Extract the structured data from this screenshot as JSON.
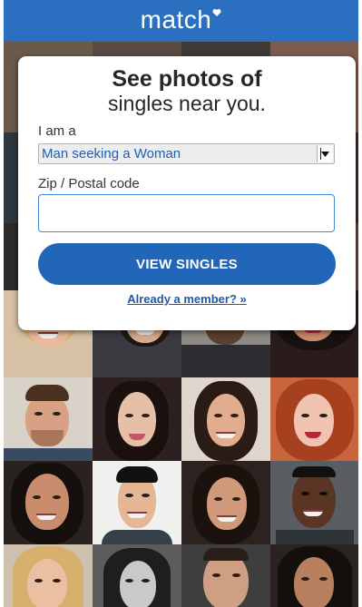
{
  "brand": {
    "logo_text": "match",
    "logo_icon": "heart-icon",
    "header_color": "#2a6fc0"
  },
  "card": {
    "title": "See photos of",
    "subtitle": "singles near you."
  },
  "form": {
    "seeking_label": "I am a",
    "seeking_value": "Man seeking a Woman",
    "zip_label": "Zip / Postal code",
    "zip_value": "",
    "submit_label": "VIEW SINGLES",
    "submit_color": "#2166b8"
  },
  "links": {
    "member_link": "Already a member? »"
  },
  "photo_grid": {
    "rows": 4,
    "columns": 4,
    "content": "profile photos"
  }
}
